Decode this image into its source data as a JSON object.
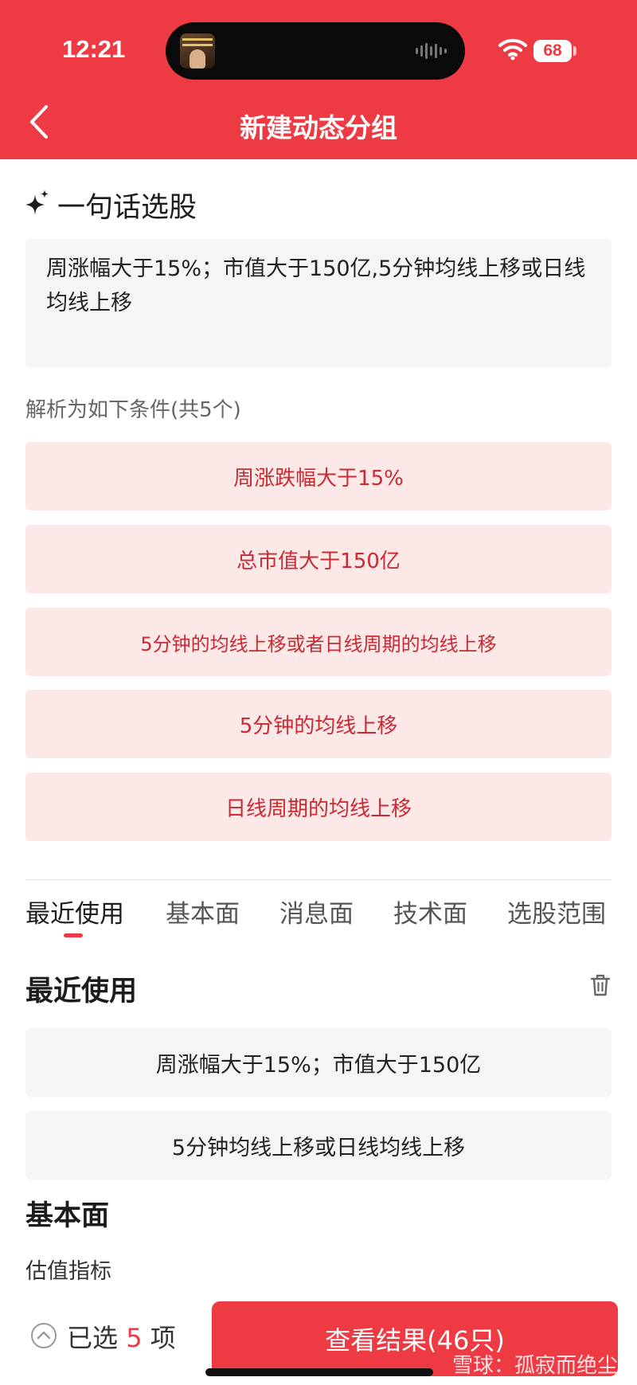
{
  "status_bar": {
    "time": "12:21",
    "battery": "68"
  },
  "nav": {
    "title": "新建动态分组",
    "back_icon": "chevron-left-icon"
  },
  "ai_section": {
    "title": "一句话选股",
    "icon": "sparkle-icon",
    "query": "周涨幅大于15%；市值大于150亿,5分钟均线上移或日线均线上移"
  },
  "parsed": {
    "label": "解析为如下条件(共5个)",
    "conditions": [
      "周涨跌幅大于15%",
      "总市值大于150亿",
      "5分钟的均线上移或者日线周期的均线上移",
      "5分钟的均线上移",
      "日线周期的均线上移"
    ]
  },
  "tabs": [
    "最近使用",
    "基本面",
    "消息面",
    "技术面",
    "选股范围"
  ],
  "active_tab": "最近使用",
  "recent": {
    "title": "最近使用",
    "clear_icon": "trash-icon",
    "items": [
      "周涨幅大于15%；市值大于150亿",
      "5分钟均线上移或日线均线上移"
    ]
  },
  "fundamentals": {
    "title": "基本面",
    "subcategory": "估值指标"
  },
  "bottom": {
    "selected_prefix": "已选",
    "selected_count": "5",
    "selected_suffix": "项",
    "cta_label": "查看结果(46只)",
    "watermark": "雪球：孤寂而绝尘"
  },
  "colors": {
    "brand": "#ee3a43",
    "condition_bg": "#fde8e8",
    "condition_text": "#c82b33"
  }
}
